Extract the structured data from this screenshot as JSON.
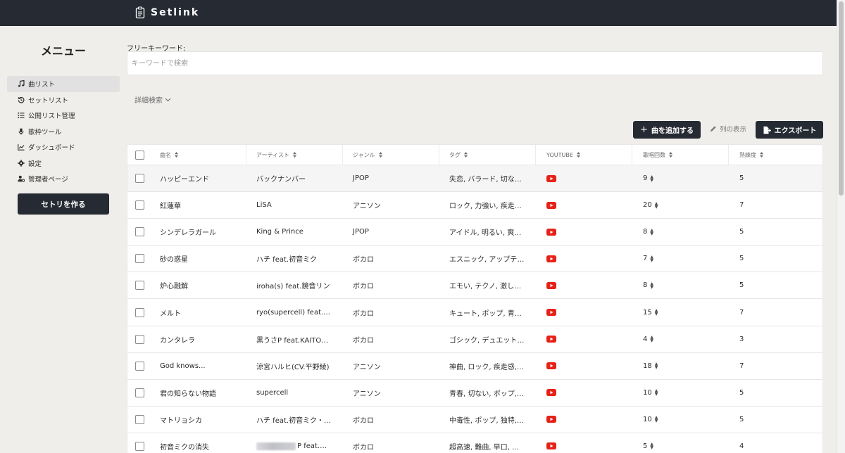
{
  "app": {
    "name": "Setlink"
  },
  "sidebar": {
    "title": "メニュー",
    "items": [
      {
        "label": "曲リスト",
        "icon": "music-icon",
        "active": true
      },
      {
        "label": "セットリスト",
        "icon": "history-icon",
        "active": false
      },
      {
        "label": "公開リスト管理",
        "icon": "list-icon",
        "active": false
      },
      {
        "label": "歌枠ツール",
        "icon": "microphone-icon",
        "active": false
      },
      {
        "label": "ダッシュボード",
        "icon": "chart-icon",
        "active": false
      },
      {
        "label": "設定",
        "icon": "gear-icon",
        "active": false
      },
      {
        "label": "管理者ページ",
        "icon": "user-gear-icon",
        "active": false
      }
    ],
    "create_button": "セトリを作る"
  },
  "search": {
    "label": "フリーキーワード:",
    "placeholder": "キーワードで検索",
    "advanced": "詳細検索"
  },
  "toolbar": {
    "add": "曲を追加する",
    "columns": "列の表示",
    "export": "エクスポート"
  },
  "table": {
    "headers": {
      "title": "曲名",
      "artist": "アーティスト",
      "genre": "ジャンル",
      "tags": "タグ",
      "youtube": "YOUTUBE",
      "count": "歌唱回数",
      "proficiency": "熟練度"
    },
    "rows": [
      {
        "title": "ハッピーエンド",
        "artist": "バックナンバー",
        "genre": "JPOP",
        "tags": "失恋, バラード, 切な…",
        "count": "9",
        "proficiency": "5"
      },
      {
        "title": "紅蓮華",
        "artist": "LiSA",
        "genre": "アニソン",
        "tags": "ロック, 力強い, 疾走…",
        "count": "20",
        "proficiency": "7"
      },
      {
        "title": "シンデレラガール",
        "artist": "King & Prince",
        "genre": "JPOP",
        "tags": "アイドル, 明るい, 爽…",
        "count": "8",
        "proficiency": "5"
      },
      {
        "title": "砂の惑星",
        "artist": "ハチ feat.初音ミク",
        "genre": "ボカロ",
        "tags": "エスニック, アップテ…",
        "count": "7",
        "proficiency": "5"
      },
      {
        "title": "炉心融解",
        "artist": "iroha(s) feat.鏡音リン",
        "genre": "ボカロ",
        "tags": "エモい, テクノ, 激し…",
        "count": "8",
        "proficiency": "5"
      },
      {
        "title": "メルト",
        "artist": "ryo(supercell) feat.…",
        "genre": "ボカロ",
        "tags": "キュート, ポップ, 青…",
        "count": "15",
        "proficiency": "7"
      },
      {
        "title": "カンタレラ",
        "artist": "黒うさP feat.KAITO…",
        "genre": "ボカロ",
        "tags": "ゴシック, デュエット…",
        "count": "4",
        "proficiency": "3"
      },
      {
        "title": "God knows...",
        "artist": "涼宮ハルヒ(CV.平野綾)",
        "genre": "アニソン",
        "tags": "神曲, ロック, 疾走感, …",
        "count": "18",
        "proficiency": "7"
      },
      {
        "title": "君の知らない物語",
        "artist": "supercell",
        "genre": "アニソン",
        "tags": "青春, 切ない, ポップ, …",
        "count": "10",
        "proficiency": "5"
      },
      {
        "title": "マトリョシカ",
        "artist": "ハチ feat.初音ミク・…",
        "genre": "ボカロ",
        "tags": "中毒性, ポップ, 独特, …",
        "count": "10",
        "proficiency": "5"
      },
      {
        "title": "初音ミクの消失",
        "artist": "P feat.…",
        "genre": "ボカロ",
        "tags": "超高速, 難曲, 早口, 盛…",
        "count": "5",
        "proficiency": "4"
      }
    ]
  },
  "colors": {
    "header": "#252a33",
    "background": "#efeeeb",
    "youtube": "#e62117"
  }
}
